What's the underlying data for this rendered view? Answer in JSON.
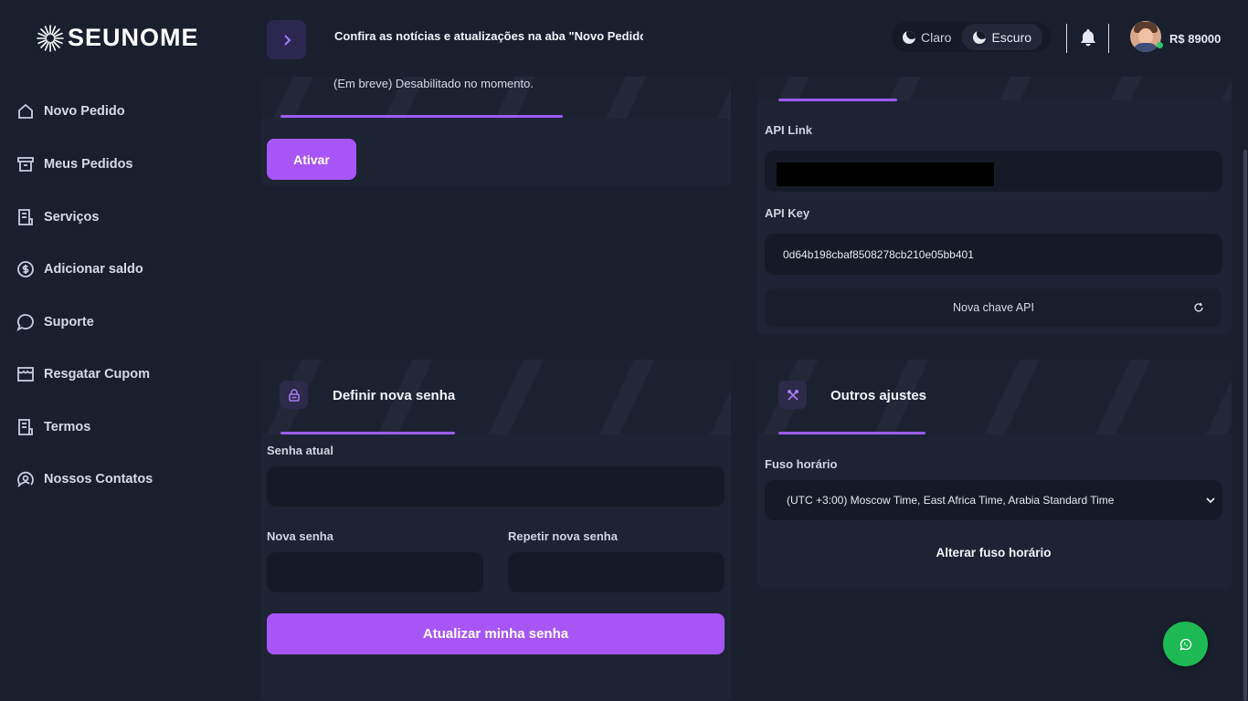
{
  "brand": {
    "name": "SEUNOME"
  },
  "sidebar": {
    "items": [
      {
        "label": "Novo Pedido",
        "icon": "home-icon"
      },
      {
        "label": "Meus Pedidos",
        "icon": "archive-icon"
      },
      {
        "label": "Serviços",
        "icon": "list-icon"
      },
      {
        "label": "Adicionar saldo",
        "icon": "dollar-icon"
      },
      {
        "label": "Suporte",
        "icon": "chat-icon"
      },
      {
        "label": "Resgatar Cupom",
        "icon": "store-icon"
      },
      {
        "label": "Termos",
        "icon": "document-icon"
      },
      {
        "label": "Nossos Contatos",
        "icon": "contacts-icon"
      }
    ]
  },
  "topbar": {
    "announcement": "Confira as notícias e atualizações na aba \"Novo Pedido\"",
    "theme_light": "Claro",
    "theme_dark": "Escuro",
    "balance": "R$ 89000"
  },
  "affiliate_card": {
    "description": "(Em breve) Desabilitado no momento.",
    "activate_label": "Ativar"
  },
  "api_card": {
    "api_link_label": "API Link",
    "api_key_label": "API Key",
    "api_key_value": "0d64b198cbaf8508278cb210e05bb401",
    "new_key_label": "Nova chave API"
  },
  "password_card": {
    "title": "Definir nova senha",
    "current_label": "Senha atual",
    "new_label": "Nova senha",
    "repeat_label": "Repetir nova senha",
    "submit_label": "Atualizar minha senha"
  },
  "other_card": {
    "title": "Outros ajustes",
    "timezone_label": "Fuso horário",
    "timezone_value": "(UTC +3:00) Moscow Time, East Africa Time, Arabia Standard Time",
    "submit_label": "Alterar fuso horário"
  },
  "colors": {
    "accent": "#a855f7",
    "background": "#1a1f2e",
    "card": "#1e2333",
    "whatsapp": "#1db954"
  }
}
